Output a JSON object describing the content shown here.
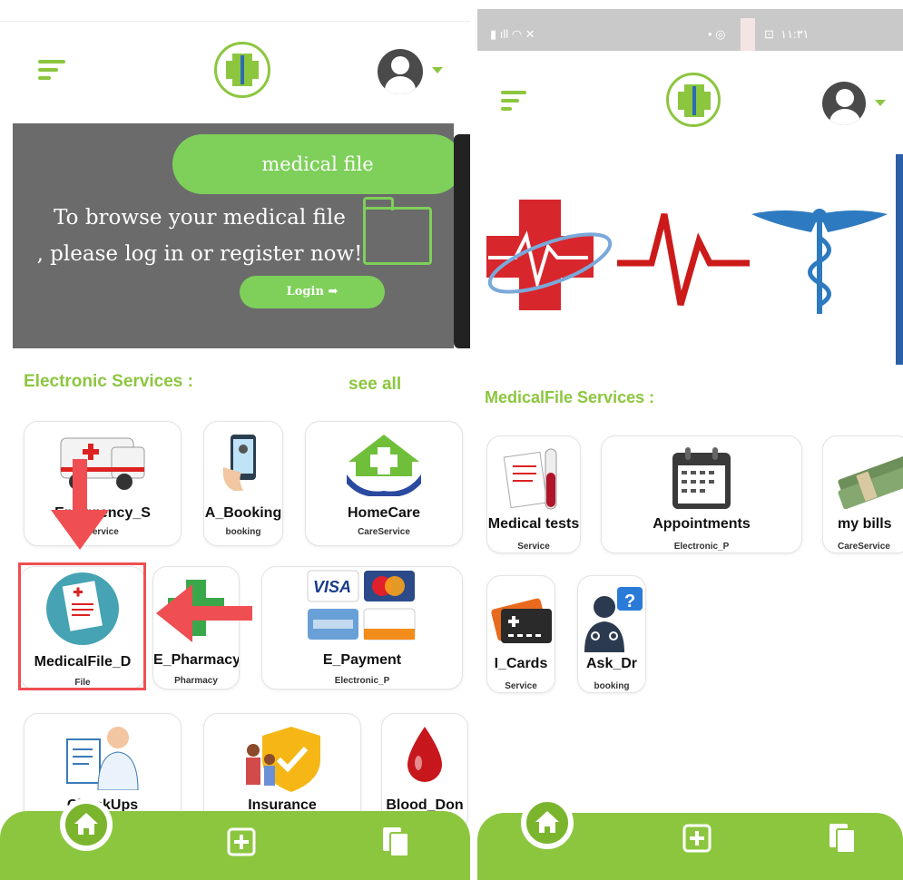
{
  "left": {
    "banner": {
      "pill_label": "medical file",
      "line1": "To browse your medical file",
      "line2": ", please log in or register now!",
      "login_label": "Login"
    },
    "section_title": "Electronic Services :",
    "see_all_label": "see all",
    "services": [
      {
        "title": "Emergency_S",
        "sub": "Service",
        "icon": "ambulance-icon"
      },
      {
        "title": "A_Booking",
        "sub": "booking",
        "icon": "phone-booking-icon"
      },
      {
        "title": "HomeCare",
        "sub": "CareService",
        "icon": "home-care-icon"
      },
      {
        "title": "MedicalFile_D",
        "sub": "File",
        "icon": "medical-file-icon"
      },
      {
        "title": "E_Pharmacy",
        "sub": "Pharmacy",
        "icon": "pharmacy-cross-icon"
      },
      {
        "title": "E_Payment",
        "sub": "Electronic_P",
        "icon": "payment-cards-icon"
      },
      {
        "title": "CheckUps",
        "sub": "",
        "icon": "doctor-clipboard-icon"
      },
      {
        "title": "Insurance",
        "sub": "",
        "icon": "family-shield-icon"
      },
      {
        "title": "Blood_Don",
        "sub": "",
        "icon": "blood-drop-icon"
      }
    ]
  },
  "right": {
    "status": {
      "time": "١١:٣١"
    },
    "section_title": "MedicalFile Services :",
    "services": [
      {
        "title": "Medical tests",
        "sub": "Service",
        "icon": "test-tube-report-icon"
      },
      {
        "title": "Appointments",
        "sub": "Electronic_P",
        "icon": "calendar-icon"
      },
      {
        "title": "my bills",
        "sub": "CareService",
        "icon": "money-stack-icon"
      },
      {
        "title": "I_Cards",
        "sub": "Service",
        "icon": "id-card-icon"
      },
      {
        "title": "Ask_Dr",
        "sub": "booking",
        "icon": "doctor-question-icon"
      }
    ]
  },
  "colors": {
    "accent": "#8cc63f",
    "banner_gray": "#6b6b6b",
    "highlight_red": "#ef4f52"
  }
}
